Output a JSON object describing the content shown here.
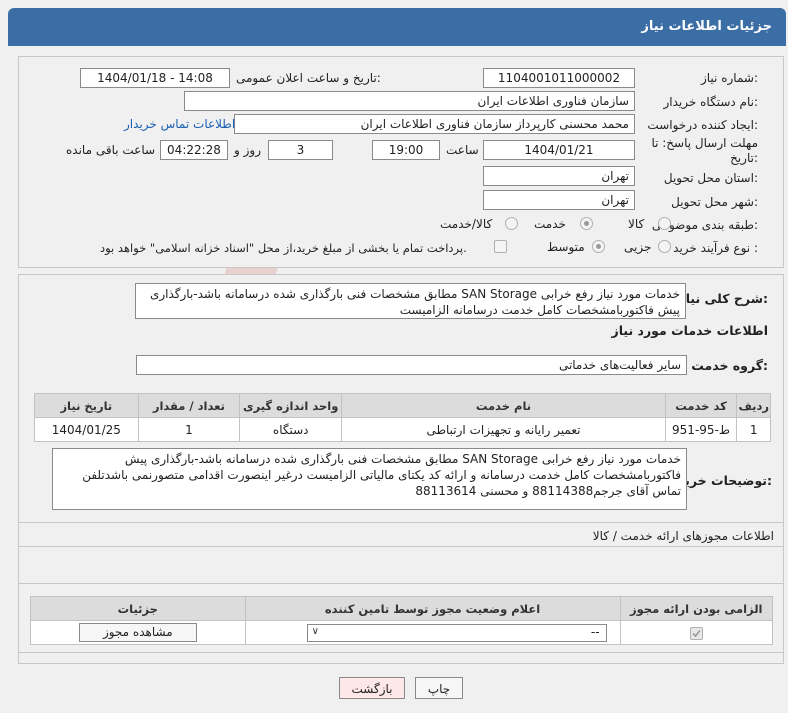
{
  "header": {
    "title": "جزئیات اطلاعات نیاز"
  },
  "form": {
    "need_number_label": "شماره نیاز:",
    "need_number": "1104001011000002",
    "announce_label": "تاریخ و ساعت اعلان عمومی:",
    "announce_value": "1404/01/18 - 14:08",
    "buyer_org_label": "نام دستگاه خریدار:",
    "buyer_org": "سازمان فناوری اطلاعات ایران",
    "requester_label": "ایجاد کننده درخواست:",
    "requester": "محمد محسنی کارپرداز سازمان فناوری اطلاعات ایران",
    "contact_link": "اطلاعات تماس خریدار",
    "deadline_label": "مهلت ارسال پاسخ: تا تاریخ:",
    "deadline_date": "1404/01/21",
    "time_label": "ساعت",
    "deadline_time": "19:00",
    "days_value": "3",
    "days_label": "روز و",
    "remaining_time": "04:22:28",
    "remaining_label": "ساعت باقی مانده",
    "province_label": "استان محل تحویل:",
    "province": "تهران",
    "city_label": "شهر محل تحویل:",
    "city": "تهران",
    "category_label": "طبقه بندی موضوعی:",
    "category_options": [
      "کالا",
      "خدمت",
      "کالا/خدمت"
    ],
    "process_label": "نوع فرآیند خرید :",
    "process_options": [
      "جزیی",
      "متوسط"
    ],
    "payment_note": "پرداخت تمام یا بخشی از مبلغ خرید،از محل \"اسناد خزانه اسلامی\" خواهد بود."
  },
  "summary": {
    "label": "شرح کلی نیاز:",
    "text": "خدمات مورد نیاز رفع خرابی SAN Storage مطابق مشخصات فنی بارگذاری شده درسامانه باشد-بارگذاری پیش فاکتوربامشخصات کامل خدمت درسامانه  الزامیست"
  },
  "services": {
    "section_title": "اطلاعات خدمات مورد نیاز",
    "group_label": "گروه خدمت:",
    "group_value": "سایر فعالیت‌های خدماتی",
    "columns": [
      "ردیف",
      "کد خدمت",
      "نام خدمت",
      "واحد اندازه گیری",
      "تعداد / مقدار",
      "تاریخ نیاز"
    ],
    "rows": [
      [
        "1",
        "ط-95-951",
        "تعمیر رایانه و تجهیزات ارتباطی",
        "دستگاه",
        "1",
        "1404/01/25"
      ]
    ]
  },
  "buyer_notes": {
    "label": "توضیحات خریدار:",
    "text": "خدمات مورد نیاز رفع خرابی SAN Storage مطابق مشخصات فنی بارگذاری شده درسامانه باشد-بارگذاری پیش فاکتوربامشخصات کامل خدمت درسامانه و ارائه کد یکتای مالیاتی الزامیست درغیر اینصورت اقدامی متصورنمی باشدتلفن تماس آقای جرجم88114388 و محسنی 88113614"
  },
  "permits": {
    "title": "اطلاعات مجوزهای ارائه خدمت / کالا",
    "columns": [
      "الزامی بودن ارائه مجوز",
      "اعلام وضعیت مجوز توسط تامین کننده",
      "جزئیات"
    ],
    "status_value": "--",
    "view_button": "مشاهده مجوز"
  },
  "footer": {
    "print_button": "چاپ",
    "back_button": "بازگشت"
  },
  "watermark": {
    "text": "AriaTender.neT"
  }
}
